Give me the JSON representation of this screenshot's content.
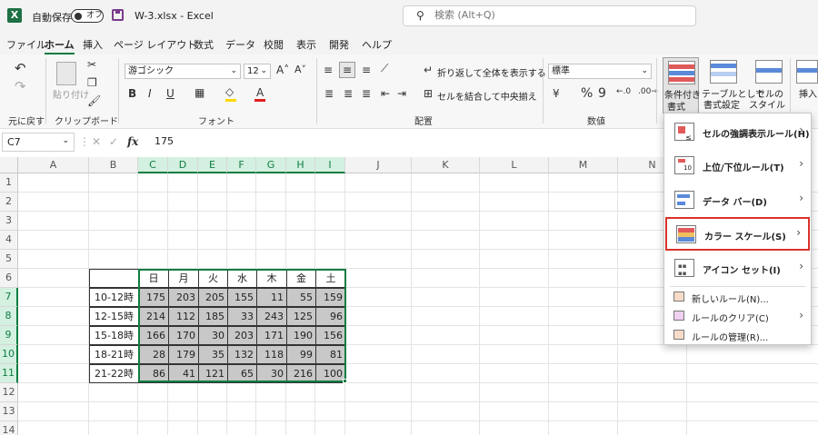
{
  "titlebar": {
    "app_logo": "X",
    "autosave_label": "自動保存",
    "toggle_state": "オフ",
    "file_title": "W-3.xlsx  -  Excel",
    "search_placeholder": "検索 (Alt+Q)"
  },
  "menu_tabs": [
    "ファイル",
    "ホーム",
    "挿入",
    "ページ レイアウト",
    "数式",
    "データ",
    "校閲",
    "表示",
    "開発",
    "ヘルプ"
  ],
  "active_tab": "ホーム",
  "ribbon": {
    "undo_group": "元に戻す",
    "clipboard_group": "クリップボード",
    "paste_label": "貼り付け",
    "font_group": "フォント",
    "font_name": "游ゴシック",
    "font_size": "12",
    "alignment_group": "配置",
    "wrap_text": "折り返して全体を表示する",
    "merge_center": "セルを結合して中央揃え",
    "number_group": "数値",
    "number_format": "標準",
    "currency_symbol": "¥",
    "percent_symbol": "%",
    "comma_symbol": "9",
    "cond_format_l1": "条件付き",
    "cond_format_l2": "書式",
    "table_format_l1": "テーブルとして",
    "table_format_l2": "書式設定",
    "cell_style_l1": "セルの",
    "cell_style_l2": "スタイル",
    "insert_label": "挿入",
    "bold": "B",
    "italic": "I",
    "underline": "U",
    "font_color_letter": "A",
    "font_color": "#e02020",
    "fill_color": "#ffd800",
    "accent": "#107c41"
  },
  "formula_bar": {
    "name_box": "C7",
    "fx": "fx",
    "formula": "175"
  },
  "sheet": {
    "columns": [
      "A",
      "B",
      "C",
      "D",
      "E",
      "F",
      "G",
      "H",
      "I",
      "J",
      "K",
      "L",
      "M",
      "N"
    ],
    "rows": [
      "1",
      "2",
      "3",
      "4",
      "5",
      "6",
      "7",
      "8",
      "9",
      "10",
      "11",
      "12",
      "13",
      "14"
    ],
    "day_headers": [
      "日",
      "月",
      "火",
      "水",
      "木",
      "金",
      "土"
    ],
    "time_slots": [
      "10-12時",
      "12-15時",
      "15-18時",
      "18-21時",
      "21-22時"
    ],
    "values": [
      [
        175,
        203,
        205,
        155,
        11,
        55,
        159
      ],
      [
        214,
        112,
        185,
        33,
        243,
        125,
        96
      ],
      [
        166,
        170,
        30,
        203,
        171,
        190,
        156
      ],
      [
        28,
        179,
        35,
        132,
        118,
        99,
        81
      ],
      [
        86,
        41,
        121,
        65,
        30,
        216,
        100
      ]
    ]
  },
  "cf_menu": {
    "items": [
      {
        "label": "セルの強調表示ルール(H)",
        "icon": "highlight-rules-icon"
      },
      {
        "label": "上位/下位ルール(T)",
        "icon": "top-bottom-rules-icon"
      },
      {
        "label": "データ バー(D)",
        "icon": "data-bars-icon"
      },
      {
        "label": "カラー スケール(S)",
        "icon": "color-scales-icon"
      },
      {
        "label": "アイコン セット(I)",
        "icon": "icon-sets-icon"
      }
    ],
    "sub_items": [
      {
        "label": "新しいルール(N)...",
        "icon": "new-rule-icon"
      },
      {
        "label": "ルールのクリア(C)",
        "icon": "clear-rules-icon"
      },
      {
        "label": "ルールの管理(R)...",
        "icon": "manage-rules-icon"
      }
    ],
    "highlight_color": "#d9322a",
    "top_bottom_number": "10"
  }
}
